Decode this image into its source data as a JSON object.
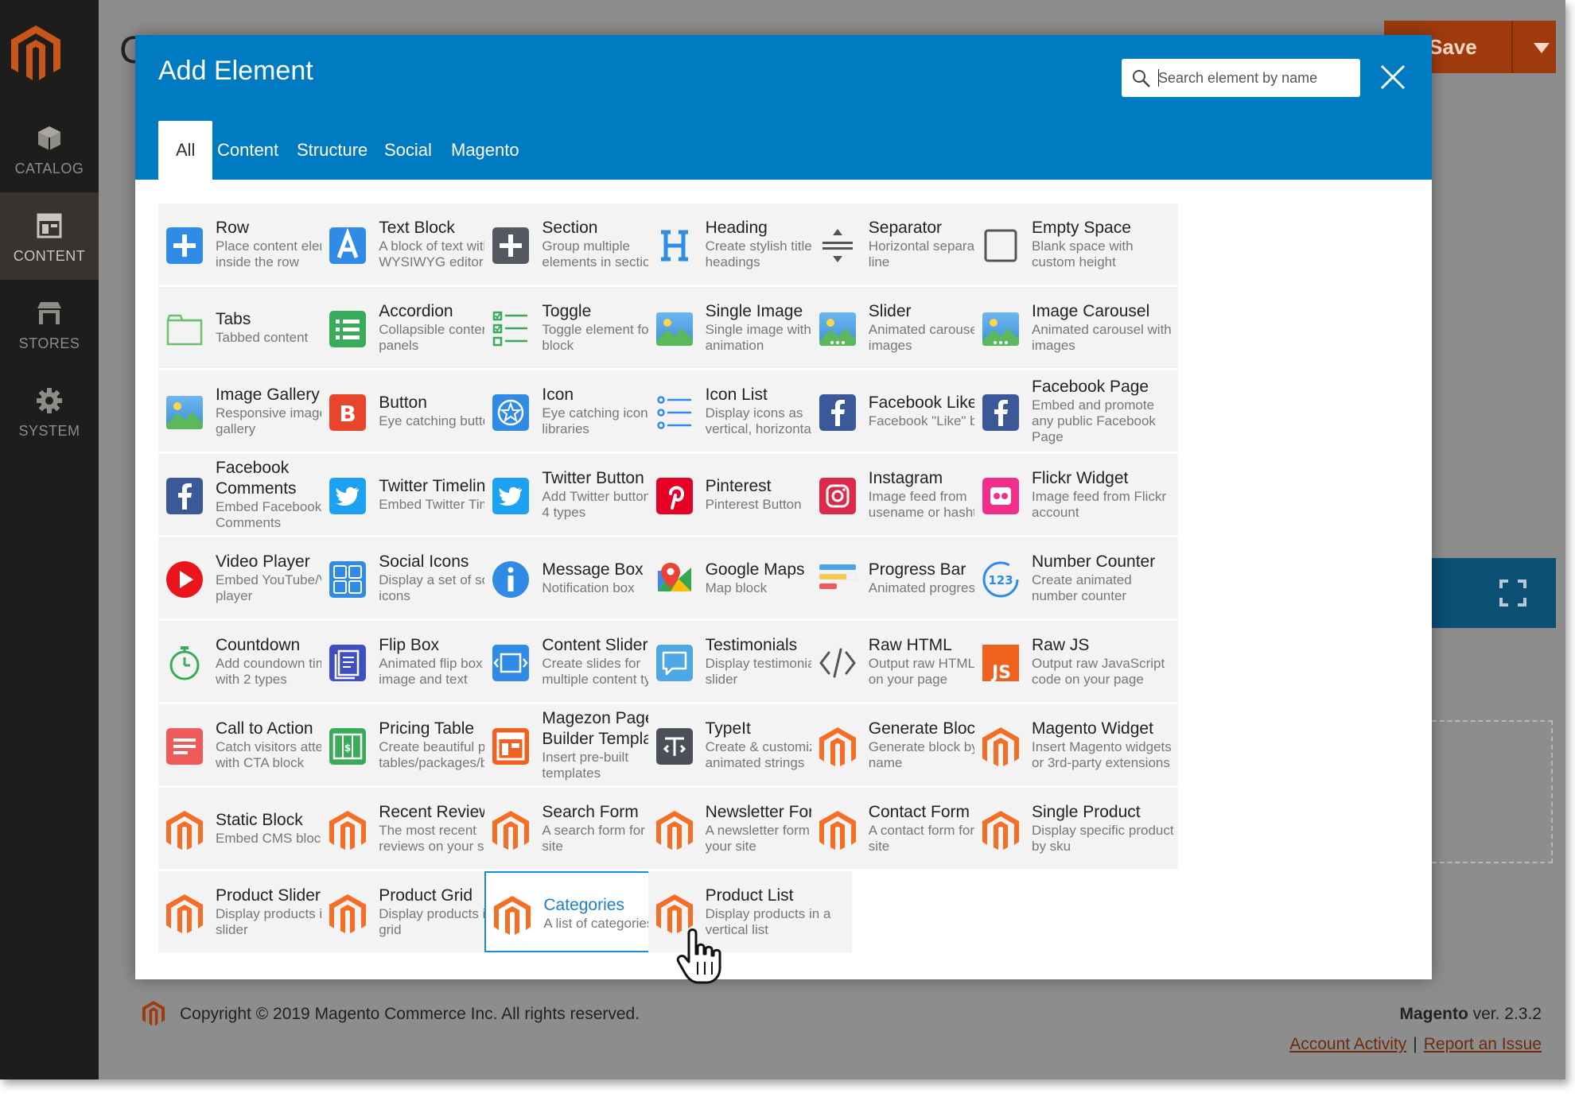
{
  "sidebar": {
    "items": [
      {
        "label": "CATALOG",
        "icon": "cube-icon"
      },
      {
        "label": "CONTENT",
        "icon": "layout-icon"
      },
      {
        "label": "STORES",
        "icon": "store-icon"
      },
      {
        "label": "SYSTEM",
        "icon": "gear-icon"
      }
    ]
  },
  "page": {
    "title_fragment": "C"
  },
  "save_button": {
    "label": "Save"
  },
  "modal": {
    "title": "Add Element",
    "search_placeholder": "Search element by name",
    "tabs": [
      "All",
      "Content",
      "Structure",
      "Social",
      "Magento"
    ],
    "active_tab": "All",
    "elements": [
      {
        "name": "Row",
        "desc": "Place content elements inside the row",
        "icon": "plus-icon"
      },
      {
        "name": "Text Block",
        "desc": "A block of text with WYSIWYG editor",
        "icon": "text-a-icon"
      },
      {
        "name": "Section",
        "desc": "Group multiple elements in section",
        "icon": "plus-dark-icon"
      },
      {
        "name": "Heading",
        "desc": "Create stylish title headings",
        "icon": "heading-h-icon"
      },
      {
        "name": "Separator",
        "desc": "Horizontal separator line",
        "icon": "separator-icon"
      },
      {
        "name": "Empty Space",
        "desc": "Blank space with custom height",
        "icon": "empty-square-icon"
      },
      {
        "name": "Tabs",
        "desc": "Tabbed content",
        "icon": "tabs-icon"
      },
      {
        "name": "Accordion",
        "desc": "Collapsible content panels",
        "icon": "accordion-icon"
      },
      {
        "name": "Toggle",
        "desc": "Toggle element for Q&A block",
        "icon": "toggle-list-icon"
      },
      {
        "name": "Single Image",
        "desc": "Single image with CSS animation",
        "icon": "image-icon"
      },
      {
        "name": "Slider",
        "desc": "Animated carousel with images",
        "icon": "slider-image-icon"
      },
      {
        "name": "Image Carousel",
        "desc": "Animated carousel with images",
        "icon": "carousel-image-icon"
      },
      {
        "name": "Image Gallery",
        "desc": "Responsive image gallery",
        "icon": "gallery-image-icon"
      },
      {
        "name": "Button",
        "desc": "Eye catching button",
        "icon": "button-b-icon"
      },
      {
        "name": "Icon",
        "desc": "Eye catching icons from libraries",
        "icon": "star-circle-icon"
      },
      {
        "name": "Icon List",
        "desc": "Display icons as vertical, horizontal list",
        "icon": "icon-list-icon"
      },
      {
        "name": "Facebook Like",
        "desc": "Facebook \"Like\" button",
        "icon": "facebook-icon"
      },
      {
        "name": "Facebook Page",
        "desc": "Embed and promote any public Facebook Page",
        "icon": "facebook-icon"
      },
      {
        "name": "Facebook Comments",
        "desc": "Embed Facebook Comments",
        "icon": "facebook-icon"
      },
      {
        "name": "Twitter Timeline",
        "desc": "Embed Twitter Timeline",
        "icon": "twitter-icon"
      },
      {
        "name": "Twitter Button",
        "desc": "Add Twitter button with 4 types",
        "icon": "twitter-icon"
      },
      {
        "name": "Pinterest",
        "desc": "Pinterest Button",
        "icon": "pinterest-icon"
      },
      {
        "name": "Instagram",
        "desc": "Image feed from usename or hashtag",
        "icon": "instagram-icon"
      },
      {
        "name": "Flickr Widget",
        "desc": "Image feed from Flickr account",
        "icon": "flickr-icon"
      },
      {
        "name": "Video Player",
        "desc": "Embed YouTube/Vimeo player",
        "icon": "play-icon"
      },
      {
        "name": "Social Icons",
        "desc": "Display a set of social icons",
        "icon": "social-icons-icon"
      },
      {
        "name": "Message Box",
        "desc": "Notification box",
        "icon": "info-icon"
      },
      {
        "name": "Google Maps",
        "desc": "Map block",
        "icon": "map-pin-icon"
      },
      {
        "name": "Progress Bar",
        "desc": "Animated progress bar",
        "icon": "progress-bar-icon"
      },
      {
        "name": "Number Counter",
        "desc": "Create animated number counter",
        "icon": "counter-123-icon"
      },
      {
        "name": "Countdown",
        "desc": "Add coundown timer with 2 types",
        "icon": "stopwatch-icon"
      },
      {
        "name": "Flip Box",
        "desc": "Animated flip box with image and text",
        "icon": "flip-box-icon"
      },
      {
        "name": "Content Slider",
        "desc": "Create slides for multiple content types",
        "icon": "content-slider-icon"
      },
      {
        "name": "Testimonials",
        "desc": "Display testimonials in slider",
        "icon": "speech-bubble-icon"
      },
      {
        "name": "Raw HTML",
        "desc": "Output raw HTML code on your page",
        "icon": "code-brackets-icon"
      },
      {
        "name": "Raw JS",
        "desc": "Output raw JavaScript code on your page",
        "icon": "js-icon"
      },
      {
        "name": "Call to Action",
        "desc": "Catch visitors attention with CTA block",
        "icon": "cta-icon"
      },
      {
        "name": "Pricing Table",
        "desc": "Create beautiful pricing tables/packages/boxes",
        "icon": "pricing-table-icon"
      },
      {
        "name": "Magezon Page Builder Template",
        "desc": "Insert pre-built templates",
        "icon": "template-icon"
      },
      {
        "name": "TypeIt",
        "desc": "Create & customize animated strings",
        "icon": "typeit-icon"
      },
      {
        "name": "Generate Block",
        "desc": "Generate block by name",
        "icon": "magento-logo-icon"
      },
      {
        "name": "Magento Widget",
        "desc": "Insert Magento widgets or 3rd-party extensions",
        "icon": "magento-logo-icon"
      },
      {
        "name": "Static Block",
        "desc": "Embed CMS blocks",
        "icon": "magento-logo-icon"
      },
      {
        "name": "Recent Reviews",
        "desc": "The most recent reviews on your site",
        "icon": "magento-logo-icon"
      },
      {
        "name": "Search Form",
        "desc": "A search form for your site",
        "icon": "magento-logo-icon"
      },
      {
        "name": "Newsletter Form",
        "desc": "A newsletter form for your site",
        "icon": "magento-logo-icon"
      },
      {
        "name": "Contact Form",
        "desc": "A contact form for your site",
        "icon": "magento-logo-icon"
      },
      {
        "name": "Single Product",
        "desc": "Display specific product by sku",
        "icon": "magento-logo-icon"
      },
      {
        "name": "Product Slider",
        "desc": "Display products in a slider",
        "icon": "magento-logo-icon"
      },
      {
        "name": "Product Grid",
        "desc": "Display products in a grid",
        "icon": "magento-logo-icon"
      },
      {
        "name": "Categories",
        "desc": "A list of categories",
        "icon": "magento-logo-icon",
        "selected": true
      },
      {
        "name": "Product List",
        "desc": "Display products in a vertical list",
        "icon": "magento-logo-icon"
      }
    ]
  },
  "footer": {
    "copyright": "Copyright © 2019 Magento Commerce Inc. All rights reserved.",
    "brand": "Magento",
    "version": " ver. 2.3.2",
    "link_activity": "Account Activity",
    "link_separator": "|",
    "link_issue": "Report an Issue"
  },
  "colors": {
    "modal_header": "#007bc2",
    "sidebar": "#1f1d1b",
    "save_button": "#9f3b0e",
    "selection": "#1b8bd6",
    "magento_orange": "#f46f25"
  }
}
